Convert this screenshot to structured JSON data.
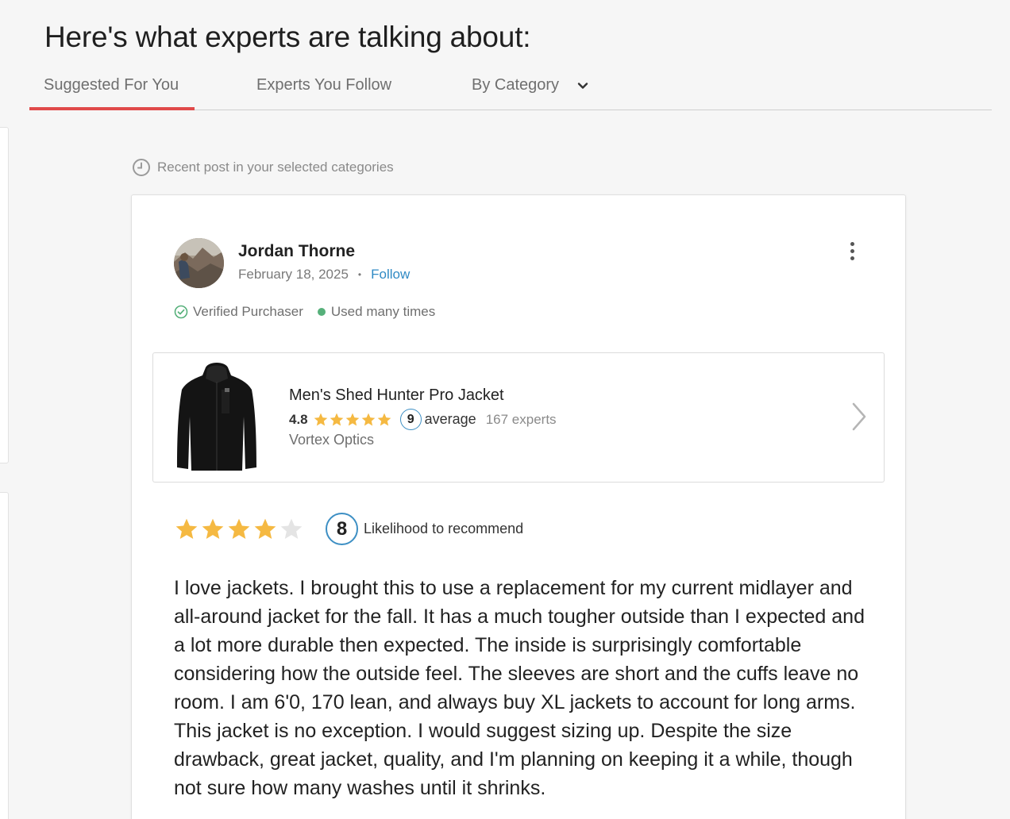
{
  "page_title": "Here's what experts are talking about:",
  "tabs": [
    {
      "label": "Suggested For You",
      "active": true
    },
    {
      "label": "Experts You Follow",
      "active": false
    },
    {
      "label": "By Category",
      "active": false
    }
  ],
  "recent_note": "Recent post in your selected categories",
  "post": {
    "author": "Jordan Thorne",
    "date": "February 18, 2025",
    "separator": "•",
    "follow_label": "Follow",
    "badges": {
      "verified": "Verified Purchaser",
      "usage": "Used many times"
    },
    "product": {
      "name": "Men's Shed Hunter Pro Jacket",
      "rating": "4.8",
      "expert_score": "9",
      "score_label": "average",
      "expert_count": "167 experts",
      "brand": "Vortex Optics",
      "stars": 5
    },
    "review_stars": 4,
    "review_stars_max": 5,
    "recommend_score": "8",
    "recommend_label": "Likelihood to recommend",
    "body": "I love jackets. I brought this to use a replacement for my current midlayer and all-around jacket for the fall. It has a much tougher outside than I expected and a lot more durable then expected. The inside is surprisingly comfortable considering how the outside feel. The sleeves are short and the cuffs leave no room. I am 6'0, 170 lean, and always buy XL jackets to account for long arms. This jacket is no exception. I would suggest sizing up. Despite the size drawback, great jacket, quality, and I'm planning on keeping it a while, though not sure how many washes until it shrinks."
  },
  "colors": {
    "accent_underline": "#e04a4a",
    "link_blue": "#2f8ac4",
    "star_gold": "#f5b942",
    "star_empty": "#e4e4e4",
    "verified_green": "#56b07a"
  }
}
